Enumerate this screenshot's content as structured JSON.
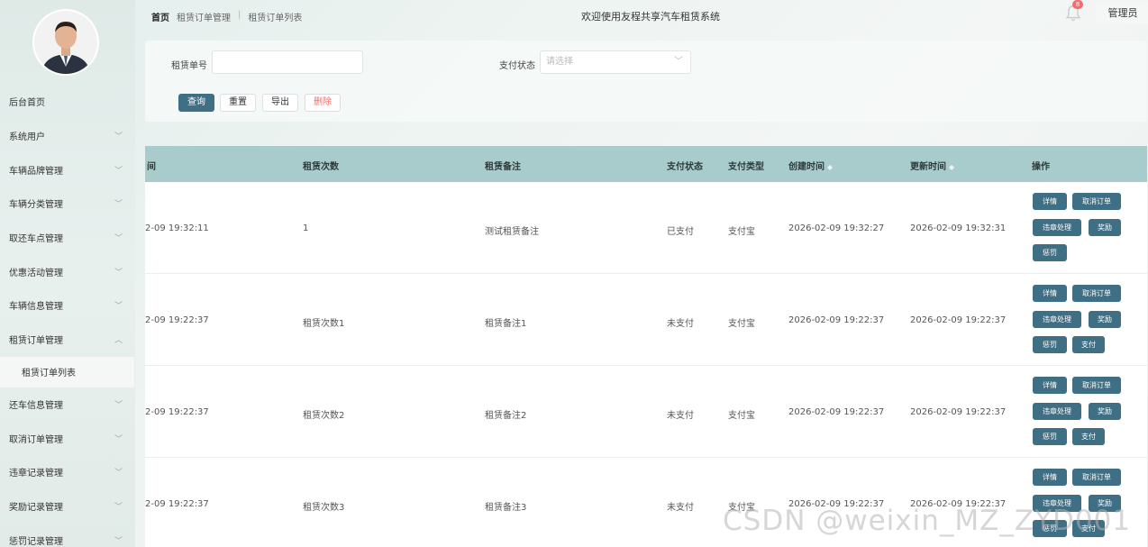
{
  "breadcrumb": [
    "首页",
    "租赁订单管理",
    "租赁订单列表"
  ],
  "system_title": "欢迎使用友程共享汽车租赁系统",
  "notification_count": "8",
  "admin_label": "管理员",
  "sidebar": {
    "items": [
      {
        "label": "后台首页",
        "chevron": false
      },
      {
        "label": "系统用户",
        "chevron": true
      },
      {
        "label": "车辆品牌管理",
        "chevron": true
      },
      {
        "label": "车辆分类管理",
        "chevron": true
      },
      {
        "label": "取还车点管理",
        "chevron": true
      },
      {
        "label": "优惠活动管理",
        "chevron": true
      },
      {
        "label": "车辆信息管理",
        "chevron": true
      },
      {
        "label": "租赁订单管理",
        "chevron": true,
        "expanded": true
      }
    ],
    "active_sub": "租赁订单列表",
    "items_after": [
      {
        "label": "还车信息管理"
      },
      {
        "label": "取消订单管理"
      },
      {
        "label": "违章记录管理"
      },
      {
        "label": "奖励记录管理"
      },
      {
        "label": "惩罚记录管理"
      }
    ]
  },
  "search": {
    "order_label": "租赁单号",
    "order_value": "",
    "pay_label": "支付状态",
    "pay_placeholder": "请选择",
    "buttons": {
      "query": "查询",
      "reset": "重置",
      "export": "导出",
      "delete": "删除"
    }
  },
  "table": {
    "headers": {
      "time": "间",
      "count": "租赁次数",
      "note": "租赁备注",
      "pay_status": "支付状态",
      "pay_type": "支付类型",
      "created": "创建时间",
      "updated": "更新时间",
      "ops": "操作"
    },
    "rows": [
      {
        "time": "2-09 19:32:11",
        "count": "1",
        "note": "测试租赁备注",
        "pay_status": "已支付",
        "pay_type": "支付宝",
        "created": "2026-02-09 19:32:27",
        "updated": "2026-02-09 19:32:31"
      },
      {
        "time": "2-09 19:22:37",
        "count": "租赁次数1",
        "note": "租赁备注1",
        "pay_status": "未支付",
        "pay_type": "支付宝",
        "created": "2026-02-09 19:22:37",
        "updated": "2026-02-09 19:22:37"
      },
      {
        "time": "2-09 19:22:37",
        "count": "租赁次数2",
        "note": "租赁备注2",
        "pay_status": "未支付",
        "pay_type": "支付宝",
        "created": "2026-02-09 19:22:37",
        "updated": "2026-02-09 19:22:37"
      },
      {
        "time": "2-09 19:22:37",
        "count": "租赁次数3",
        "note": "租赁备注3",
        "pay_status": "未支付",
        "pay_type": "支付宝",
        "created": "2026-02-09 19:22:37",
        "updated": "2026-02-09 19:22:37"
      }
    ],
    "op_labels": {
      "detail": "详情",
      "cancel": "取消订单",
      "violation": "违章处理",
      "reward": "奖励",
      "punish": "惩罚",
      "pay": "支付"
    }
  },
  "watermark": "CSDN @weixin_MZ_ZYD001",
  "colors": {
    "primary": "#3e6f84",
    "table_header": "#a8cccb",
    "danger": "#f56c6c"
  }
}
